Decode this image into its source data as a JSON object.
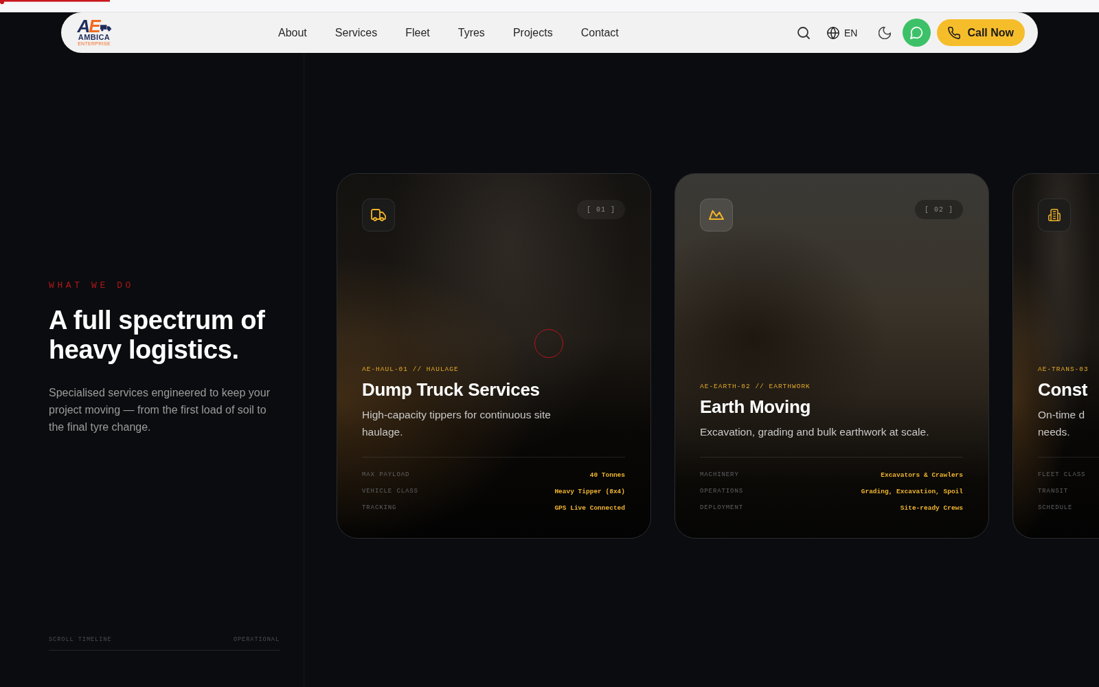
{
  "scroll_progress": {
    "level": 0.1
  },
  "header": {
    "logo": {
      "mark": "AE",
      "name": "AMBICA",
      "tagline": "ENTERPRISE"
    },
    "nav": [
      "About",
      "Services",
      "Fleet",
      "Tyres",
      "Projects",
      "Contact"
    ],
    "language": "EN",
    "call_button": "Call Now"
  },
  "intro": {
    "eyebrow": "WHAT WE DO",
    "heading": "A full spectrum of heavy logistics.",
    "text": "Specialised services engineered to keep your project moving — from the first load of soil to the final tyre change.",
    "timeline": {
      "label": "SCROLL TIMELINE",
      "status": "OPERATIONAL"
    }
  },
  "services": [
    {
      "index": "[ 01 ]",
      "code": "AE-HAUL-01 // HAULAGE",
      "title": "Dump Truck Services",
      "description": "High-capacity tippers for continuous site haulage.",
      "specs": [
        {
          "label": "MAX PAYLOAD",
          "value": "40 Tonnes"
        },
        {
          "label": "VEHICLE CLASS",
          "value": "Heavy Tipper (8x4)"
        },
        {
          "label": "TRACKING",
          "value": "GPS Live Connected"
        }
      ]
    },
    {
      "index": "[ 02 ]",
      "code": "AE-EARTH-02 // EARTHWORK",
      "title": "Earth Moving",
      "description": "Excavation, grading and bulk earthwork at scale.",
      "specs": [
        {
          "label": "MACHINERY",
          "value": "Excavators & Crawlers"
        },
        {
          "label": "OPERATIONS",
          "value": "Grading, Excavation, Spoil"
        },
        {
          "label": "DEPLOYMENT",
          "value": "Site-ready Crews"
        }
      ]
    },
    {
      "code": "AE-TRANS-03",
      "title": "Const",
      "description": "On-time d\nneeds.",
      "specs": [
        {
          "label": "FLEET CLASS"
        },
        {
          "label": "TRANSIT"
        },
        {
          "label": "SCHEDULE"
        }
      ]
    }
  ]
}
